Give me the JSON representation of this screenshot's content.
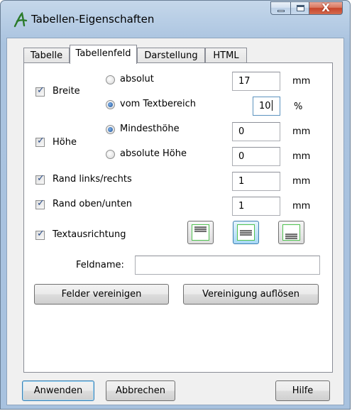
{
  "window": {
    "title": "Tabellen-Eigenschaften",
    "controls": {
      "minimize": "—",
      "maximize": "□",
      "close": "X"
    }
  },
  "tabs": [
    {
      "label": "Tabelle",
      "active": false
    },
    {
      "label": "Tabellenfeld",
      "active": true
    },
    {
      "label": "Darstellung",
      "active": false
    },
    {
      "label": "HTML",
      "active": false
    }
  ],
  "width": {
    "label": "Breite",
    "checked": true,
    "absolute": {
      "label": "absolut",
      "selected": false,
      "value": "17",
      "unit": "mm"
    },
    "relative": {
      "label": "vom Textbereich",
      "selected": true,
      "value": "10",
      "unit": "%"
    }
  },
  "height": {
    "label": "Höhe",
    "checked": true,
    "minimum": {
      "label": "Mindesthöhe",
      "selected": true,
      "value": "0",
      "unit": "mm"
    },
    "absolute": {
      "label": "absolute Höhe",
      "selected": false,
      "value": "0",
      "unit": "mm"
    }
  },
  "margin_lr": {
    "label": "Rand links/rechts",
    "checked": true,
    "value": "1",
    "unit": "mm"
  },
  "margin_tb": {
    "label": "Rand oben/unten",
    "checked": true,
    "value": "1",
    "unit": "mm"
  },
  "text_alignment": {
    "label": "Textausrichtung",
    "checked": true,
    "options": [
      "align-top",
      "align-middle",
      "align-bottom"
    ],
    "selected": "align-middle"
  },
  "field_name": {
    "label": "Feldname:",
    "value": ""
  },
  "buttons": {
    "merge": "Felder vereinigen",
    "unmerge": "Vereinigung auflösen",
    "apply": "Anwenden",
    "cancel": "Abbrechen",
    "help": "Hilfe"
  },
  "colors": {
    "accent": "#3c7fb1",
    "frame": "#aac3df",
    "close": "#c8452a",
    "align_border": "#4fc24f"
  },
  "icons": {
    "app": "handwritten-a-icon",
    "checkbox": "checkmark-icon"
  }
}
